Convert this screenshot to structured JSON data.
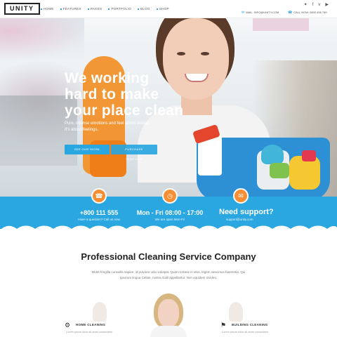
{
  "header": {
    "logo": "UNITY",
    "nav": [
      "HOME",
      "FEATURES",
      "PAGES",
      "PORTFOLIO",
      "BLOG",
      "SHOP"
    ],
    "social_icons": [
      "twitter-icon",
      "facebook-icon",
      "vimeo-icon",
      "youtube-icon"
    ],
    "email": "MAIL: INFO@UNITY.COM",
    "phone": "CALL NOW: 0800 456 789"
  },
  "hero": {
    "title_line1": "We working",
    "title_line2": "hard to make",
    "title_line3": "your place clean",
    "subtitle_line1": "Pure, intense emotions and feel about design.",
    "subtitle_line2": "It's about feelings.",
    "primary_button": "SEE OUR WORK",
    "secondary_button": "PURCHASE TEMPLATE"
  },
  "info": {
    "phone_number": "+800 111 555",
    "phone_caption": "Have a question? Call us now",
    "hours": "Mon - Fri 08:00 - 17:00",
    "hours_caption": "We are open Mon-Fri",
    "support_title": "Need support?",
    "support_email": "support@unity.com"
  },
  "section": {
    "title": "Professional Cleaning Service Company",
    "desc_line1": "Mulrit fringilla convallis sapien, id pulvinar odio volutpat. Quam tortane in vitiis, legem sancimus haerentia. Qui",
    "desc_line2": "Ipsorum lingua Celtae, nostra Galli appellantur. Non equidem invideo."
  },
  "services": [
    {
      "label": "HOME CLEANING",
      "text": "Lorem ipsum dolor sit amet consectetur"
    },
    {
      "label": "BUILDING CLEANING",
      "text": "Lorem ipsum dolor sit amet consectetur"
    }
  ],
  "colors": {
    "accent": "#2aa7e0",
    "orange": "#f68e34"
  }
}
